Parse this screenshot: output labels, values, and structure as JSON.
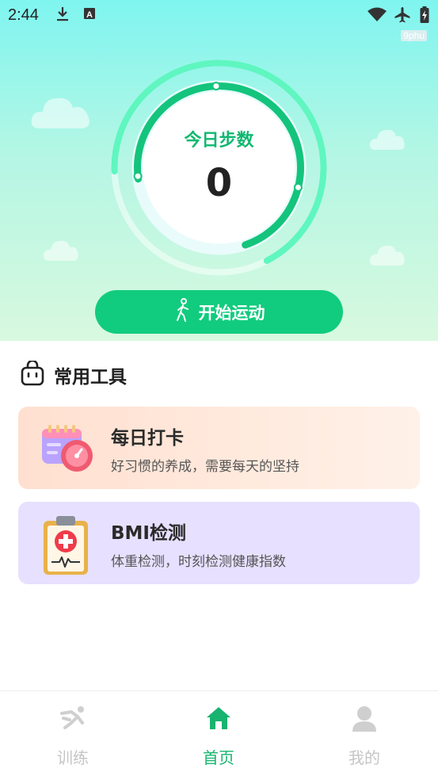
{
  "status_bar": {
    "time": "2:44",
    "watermark": "9phu",
    "icons": [
      "download-icon",
      "keyboard-a-icon",
      "wifi-icon",
      "airplane-icon",
      "battery-charging-icon"
    ]
  },
  "steps": {
    "label": "今日步数",
    "value": "0",
    "progress_arc_fraction": 0.72
  },
  "start_button": {
    "label": "开始运动",
    "icon": "walking-person-icon"
  },
  "tools": {
    "title": "常用工具",
    "icon": "bag-icon",
    "cards": [
      {
        "title": "每日打卡",
        "desc": "好习惯的养成，需要每天的坚持",
        "icon": "calendar-clock-icon"
      },
      {
        "title": "BMI检测",
        "desc": "体重检测，时刻检测健康指数",
        "icon": "medical-clipboard-icon"
      }
    ]
  },
  "bottom_nav": [
    {
      "label": "训练",
      "icon": "running-icon",
      "active": false
    },
    {
      "label": "首页",
      "icon": "home-icon",
      "active": true
    },
    {
      "label": "我的",
      "icon": "person-icon",
      "active": false
    }
  ],
  "colors": {
    "accent": "#11cc7e",
    "accent_text": "#0fb870",
    "checkin_card_bg": "#ffe7da",
    "bmi_card_bg": "#e7e0ff"
  }
}
